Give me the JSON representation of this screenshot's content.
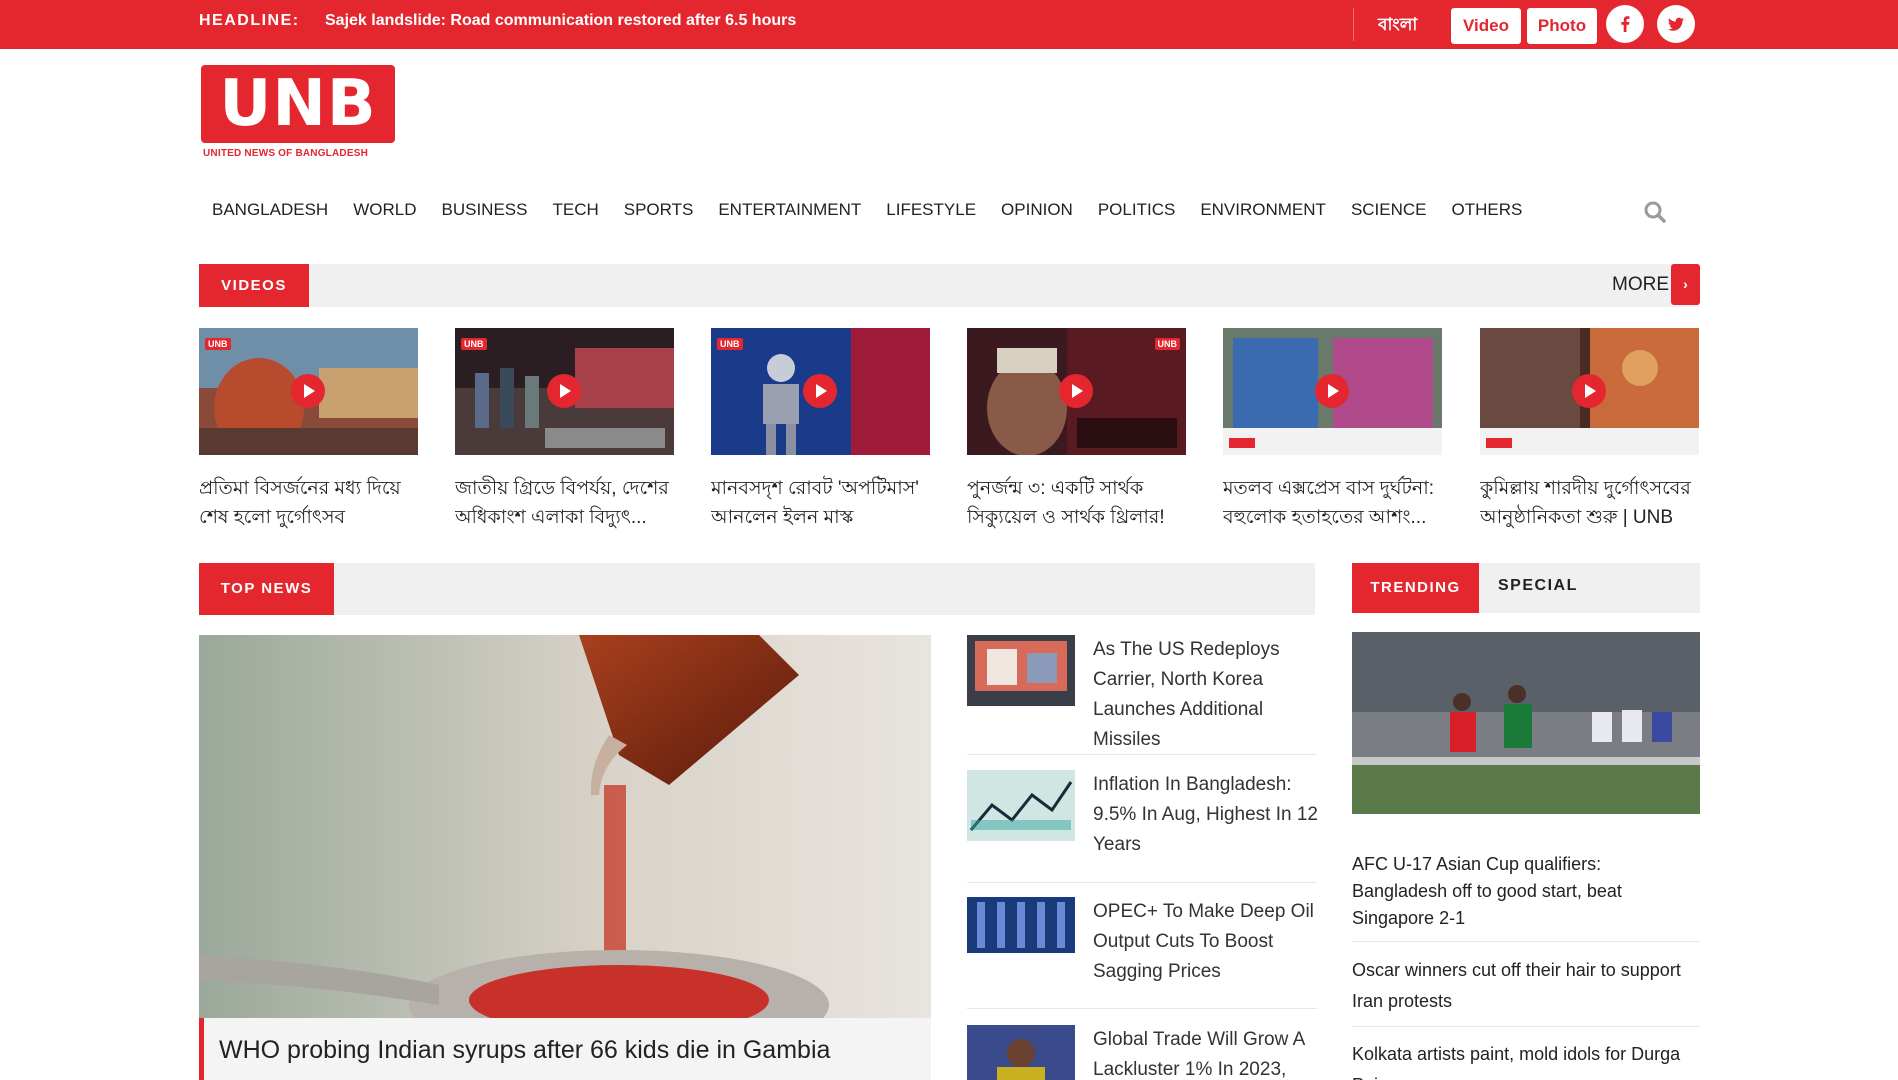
{
  "topbar": {
    "headline_label": "HEADLINE:",
    "headline_text": "Sajek landslide: Road communication restored after 6.5 hours",
    "language": "বাংলা",
    "video_label": "Video",
    "photo_label": "Photo"
  },
  "logo": {
    "name": "UNB",
    "tagline": "UNITED NEWS OF BANGLADESH"
  },
  "nav": {
    "items": [
      "BANGLADESH",
      "WORLD",
      "BUSINESS",
      "TECH",
      "SPORTS",
      "ENTERTAINMENT",
      "LIFESTYLE",
      "OPINION",
      "POLITICS",
      "ENVIRONMENT",
      "SCIENCE",
      "OTHERS"
    ]
  },
  "videos": {
    "label": "VIDEOS",
    "more_label": "MORE",
    "items": [
      {
        "title": "প্রতিমা বিসর্জনের মধ্য দিয়ে শেষ হলো দুর্গোৎসব"
      },
      {
        "title": "জাতীয় গ্রিডে বিপর্যয়, দেশের অধিকাংশ এলাকা বিদ্যুৎ..."
      },
      {
        "title": "মানবসদৃশ রোবট 'অপটিমাস' আনলেন ইলন মাস্ক"
      },
      {
        "title": "পুনর্জন্ম ৩: একটি সার্থক সিক্যুয়েল ও সার্থক থ্রিলার! |..."
      },
      {
        "title": "মতলব এক্সপ্রেস বাস দুর্ঘটনা: বহুলোক হতাহতের আশং..."
      },
      {
        "title": "কুমিল্লায় শারদীয় দুর্গোৎসবের আনুষ্ঠানিকতা শুরু | UNB"
      }
    ],
    "badge": "UNB"
  },
  "top_news": {
    "label": "TOP NEWS",
    "main_caption": "WHO probing Indian syrups after 66 kids die in Gambia",
    "side": [
      {
        "title": "As The US Redeploys Carrier, North Korea Launches Additional Missiles"
      },
      {
        "title": "Inflation In Bangladesh: 9.5% In Aug, Highest In 12 Years"
      },
      {
        "title": "OPEC+ To Make Deep Oil Output Cuts To Boost Sagging Prices"
      },
      {
        "title": "Global Trade Will Grow A Lackluster 1% In 2023,"
      }
    ]
  },
  "trending": {
    "label": "TRENDING",
    "special_label": "SPECIAL",
    "items": [
      {
        "title": "AFC U-17 Asian Cup qualifiers: Bangladesh off to good start, beat Singapore 2-1"
      },
      {
        "title": "Oscar winners cut off their hair to support Iran protests"
      },
      {
        "title": "Kolkata artists paint, mold idols for Durga Puja"
      }
    ]
  },
  "colors": {
    "brand_red": "#e4262f",
    "bar_gray": "#f0f0f0"
  }
}
